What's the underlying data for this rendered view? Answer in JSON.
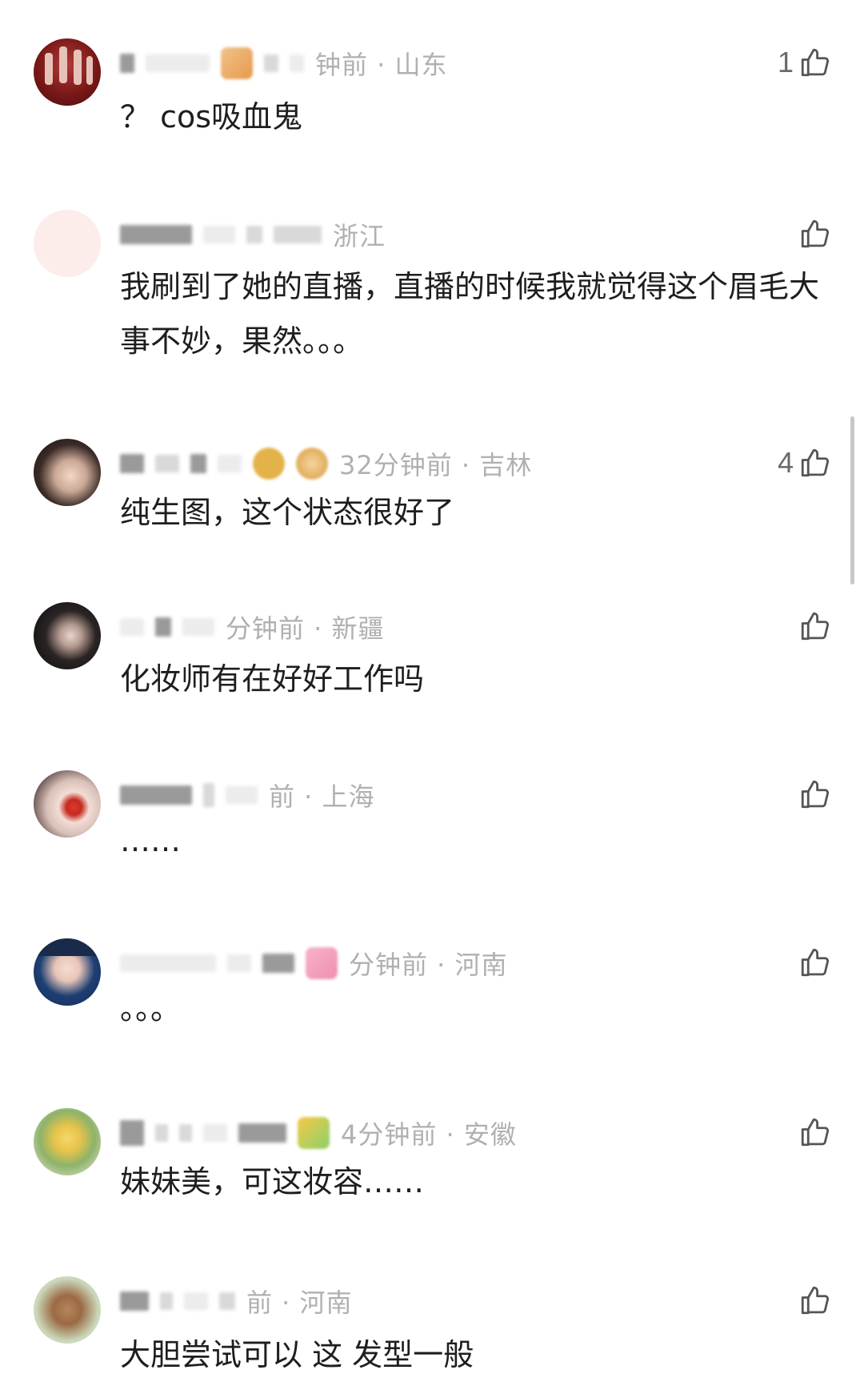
{
  "comments": [
    {
      "time_location": "钟前 · 山东",
      "text": "？ cos吸血鬼",
      "likes": "1"
    },
    {
      "time_location": "浙江",
      "text": "我刷到了她的直播，直播的时候我就觉得这个眉毛大事不妙，果然。。。",
      "likes": ""
    },
    {
      "time_location": "32分钟前 · 吉林",
      "text": "纯生图，这个状态很好了",
      "likes": "4"
    },
    {
      "time_location": "分钟前 · 新疆",
      "text": "化妆师有在好好工作吗",
      "likes": ""
    },
    {
      "time_location": "前 · 上海",
      "text": "……",
      "likes": ""
    },
    {
      "time_location": "分钟前 · 河南",
      "text": "。。。",
      "likes": ""
    },
    {
      "time_location": "4分钟前 · 安徽",
      "text": "妹妹美，可这妆容……",
      "likes": ""
    },
    {
      "time_location": "前 · 河南",
      "text": "大胆尝试可以 这 发型一般",
      "likes": ""
    }
  ],
  "icons": {
    "like": "thumbs-up-icon"
  },
  "colors": {
    "meta": "#b0b0b0",
    "text": "#1e1e1e",
    "icon": "#555555"
  }
}
